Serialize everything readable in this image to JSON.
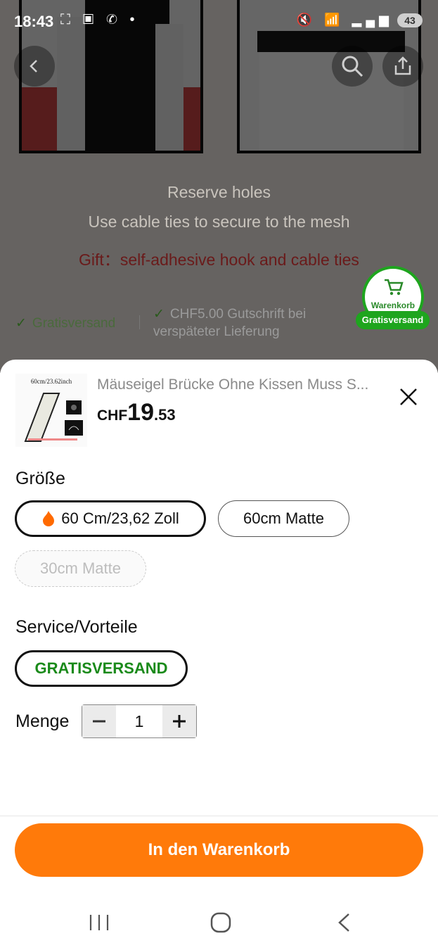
{
  "status_bar": {
    "time": "18:43",
    "app_icons": "⛶ ▣ ✆ •",
    "system_icons": "🔇 📶 ▂▄▆",
    "battery": "43"
  },
  "background_page": {
    "promo_line1": "Reserve holes",
    "promo_line2": "Use cable ties to secure to the mesh",
    "promo_line3": "Gift：self-adhesive hook and cable ties",
    "shipping_free": "Gratisversand",
    "shipping_credit": "CHF5.00 Gutschrift bei verspäteter Lieferung",
    "cart_badge_label": "Warenkorb",
    "cart_badge_pill": "Gratisversand"
  },
  "sheet": {
    "thumbnail_caption": "60cm/23.62inch",
    "product_title": "Mäuseigel Brücke Ohne Kissen Muss S...",
    "price_currency": "CHF",
    "price_integer": "19",
    "price_decimal": ".53",
    "size_heading": "Größe",
    "size_options": [
      {
        "label": "60 Cm/23,62 Zoll",
        "state": "selected"
      },
      {
        "label": "60cm Matte",
        "state": "available"
      },
      {
        "label": "30cm Matte",
        "state": "disabled"
      }
    ],
    "service_heading": "Service/Vorteile",
    "service_option": "GRATISVERSAND",
    "quantity_label": "Menge",
    "quantity_value": "1",
    "add_to_cart_label": "In den Warenkorb"
  },
  "colors": {
    "accent_orange": "#ff7a0a",
    "green": "#1ea51e"
  },
  "icons": [
    "back-icon",
    "search-icon",
    "share-icon",
    "cart-icon",
    "check-icon",
    "flame-icon",
    "close-icon",
    "minus-icon",
    "plus-icon",
    "recents-icon",
    "home-icon",
    "nav-back-icon"
  ]
}
